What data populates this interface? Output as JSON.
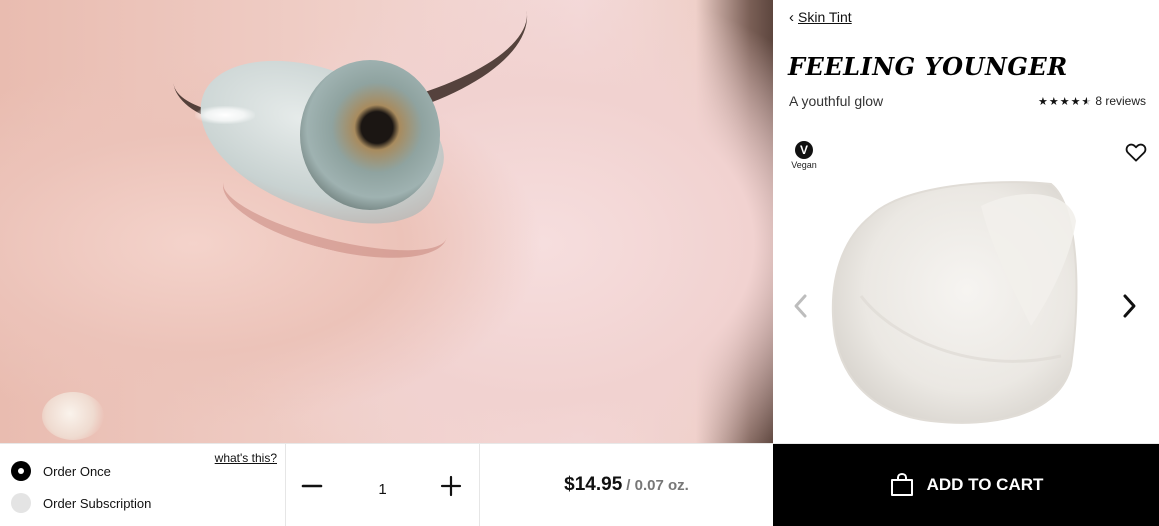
{
  "nav": {
    "back_label": "Skin Tint"
  },
  "product": {
    "title": "FEELING YOUNGER",
    "tagline": "A youthful glow",
    "rating_stars": 4.5,
    "reviews_label": "8 reviews",
    "badge_letter": "V",
    "badge_label": "Vegan"
  },
  "purchase": {
    "whats_this": "what's this?",
    "option_once": "Order Once",
    "option_subscription": "Order Subscription",
    "selected_option": "Order Once",
    "quantity": "1",
    "price": "$14.95",
    "unit": "/ 0.07 oz.",
    "add_to_cart": "ADD TO CART"
  },
  "colors": {
    "cart_button_bg": "#000000",
    "text": "#111111",
    "muted_text": "#777777"
  },
  "icons": [
    "chevron-left-icon",
    "heart-icon",
    "carousel-prev-icon",
    "carousel-next-icon",
    "minus-icon",
    "plus-icon",
    "shopping-bag-icon",
    "star-icon"
  ]
}
